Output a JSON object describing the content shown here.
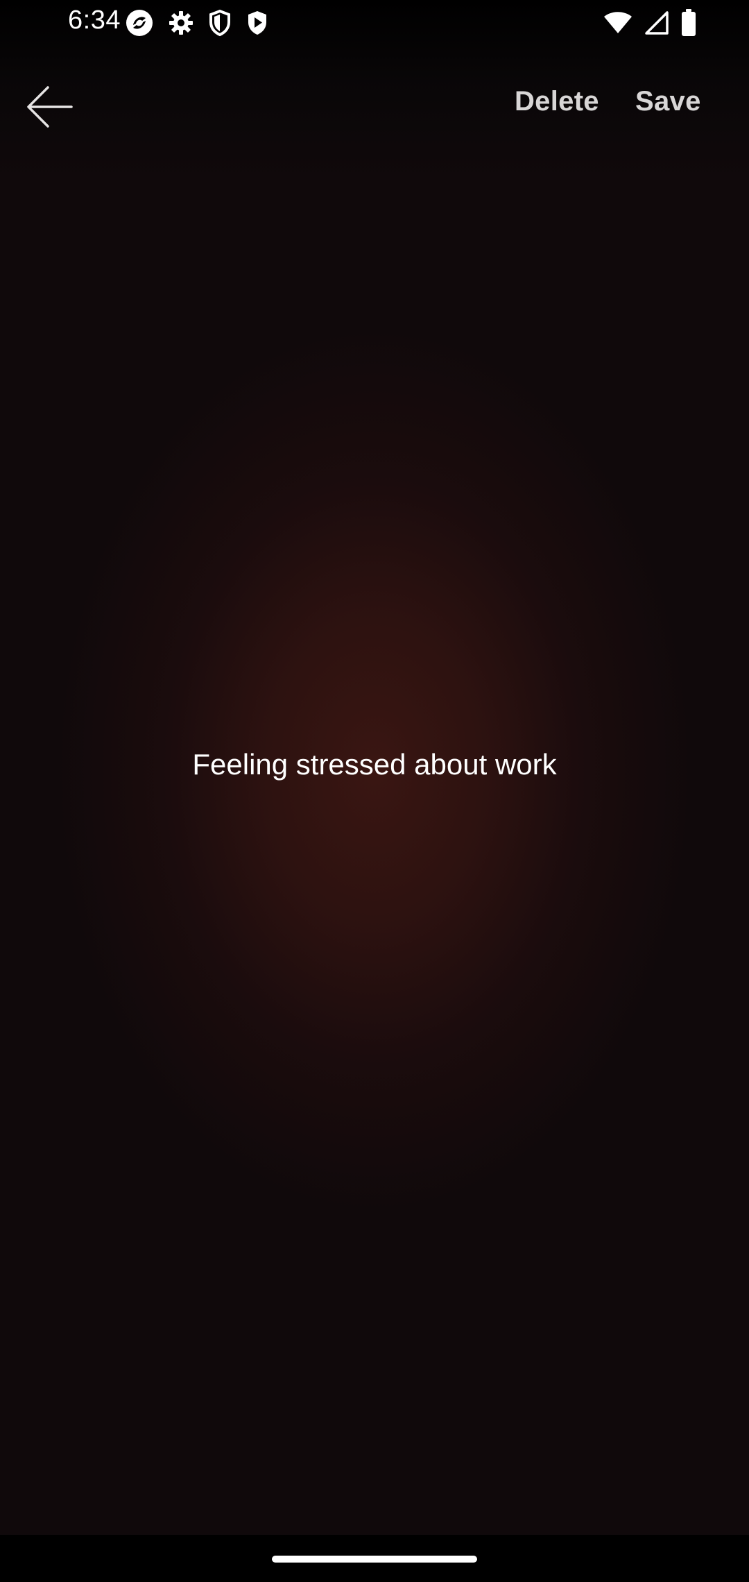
{
  "status_bar": {
    "time": "6:34",
    "left_icons": [
      "app-notification-icon",
      "settings-icon",
      "shield-icon",
      "play-store-icon"
    ],
    "right_icons": [
      "wifi-icon",
      "cellular-signal-icon",
      "battery-icon"
    ]
  },
  "app_bar": {
    "back_icon": "back-arrow-icon",
    "delete_label": "Delete",
    "save_label": "Save"
  },
  "content": {
    "entry_text": "Feeling stressed about work"
  },
  "colors": {
    "background": "#100a0c",
    "glow": "#3a1612",
    "action_text": "#d8d6d6"
  }
}
